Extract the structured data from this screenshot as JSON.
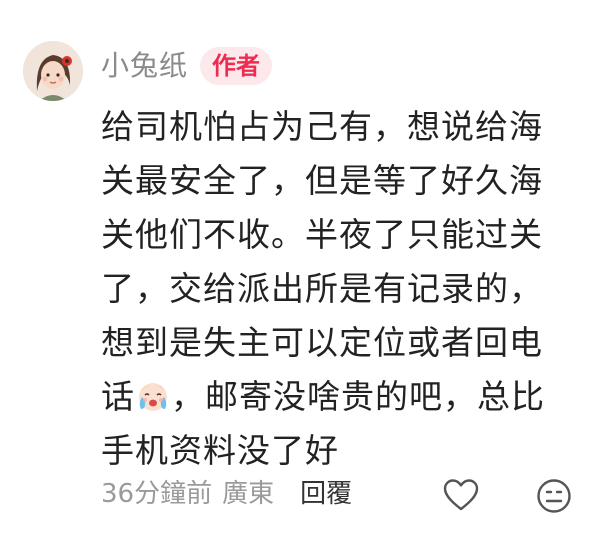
{
  "author": {
    "name": "小兔纸",
    "badge": "作者"
  },
  "comment": {
    "text_before_emoji": "给司机怕占为己有，想说给海关最安全了，但是等了好久海关他们不收。半夜了只能过关了，交给派出所是有记录的，想到是失主可以定位或者回电话",
    "emoji": "crying-face-emoji",
    "text_after_emoji": "，邮寄没啥贵的吧，总比手机资料没了好"
  },
  "meta": {
    "time": "36分鐘前",
    "location": "廣東",
    "reply_label": "回覆"
  },
  "actions": {
    "like_icon": "heart-outline-icon",
    "react_icon": "emoji-face-icon"
  },
  "colors": {
    "badge_text": "#ee2c52",
    "badge_bg": "#fde8ec",
    "meta_text": "#9a9a9a",
    "body_text": "#222222"
  }
}
